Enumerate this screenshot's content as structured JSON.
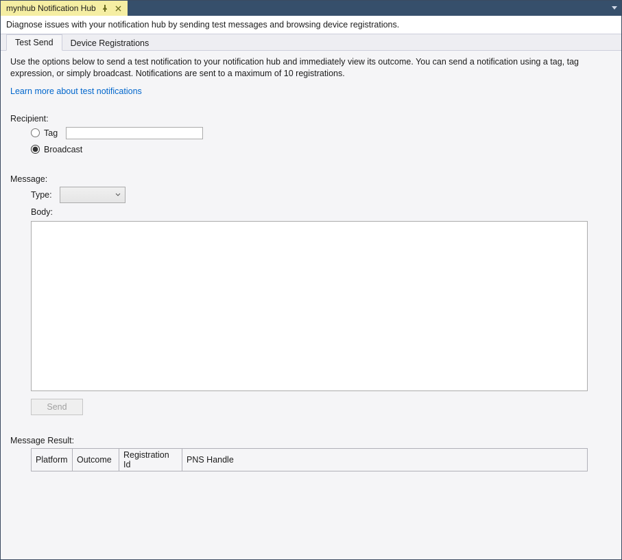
{
  "titlebar": {
    "tab_title": "mynhub Notification Hub"
  },
  "description": "Diagnose issues with your notification hub by sending test messages and browsing device registrations.",
  "subtabs": {
    "test_send": "Test Send",
    "device_registrations": "Device Registrations"
  },
  "panel": {
    "help_text": "Use the options below to send a test notification to your notification hub and immediately view its outcome. You can send a notification using a tag, tag expression, or simply broadcast. Notifications are sent to a maximum of 10 registrations.",
    "learn_more": "Learn more about test notifications",
    "recipient_label": "Recipient:",
    "tag_label": "Tag",
    "broadcast_label": "Broadcast",
    "message_label": "Message:",
    "type_label": "Type:",
    "body_label": "Body:",
    "send_button": "Send",
    "result_label": "Message Result:",
    "result_columns": {
      "platform": "Platform",
      "outcome": "Outcome",
      "registration_id": "Registration Id",
      "pns_handle": "PNS Handle"
    },
    "type_selected": "",
    "tag_value": "",
    "body_value": "",
    "recipient_selected": "broadcast"
  }
}
